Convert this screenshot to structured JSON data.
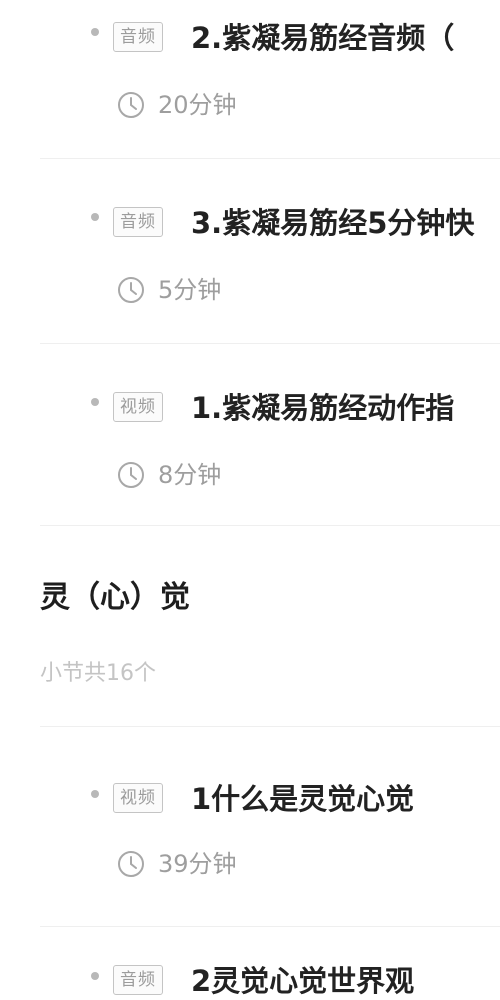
{
  "lessons_top": [
    {
      "tag": "音频",
      "title": "2.紫凝易筋经音频（",
      "duration": "20分钟"
    },
    {
      "tag": "音频",
      "title": "3.紫凝易筋经5分钟快",
      "duration": "5分钟"
    },
    {
      "tag": "视频",
      "title": "1.紫凝易筋经动作指",
      "duration": "8分钟"
    }
  ],
  "chapter": {
    "title": "灵（心）觉",
    "subtitle": "小节共16个"
  },
  "lessons_bottom": [
    {
      "tag": "视频",
      "title": "1什么是灵觉心觉",
      "duration": "39分钟"
    },
    {
      "tag": "音频",
      "title": "2灵觉心觉世界观"
    }
  ],
  "icons": {
    "bullet": "dot-icon",
    "duration": "clock-icon"
  },
  "colors": {
    "title": "#222222",
    "muted": "#9e9e9e",
    "tag_border": "#c4c4c4",
    "divider": "#efefef"
  }
}
